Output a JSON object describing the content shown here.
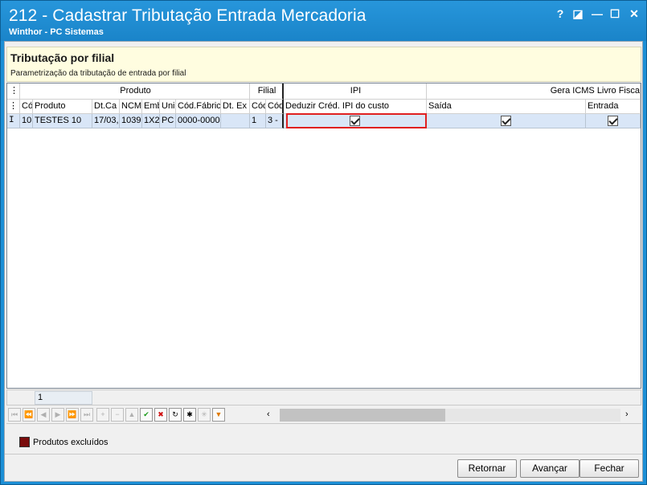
{
  "window": {
    "title": "212 - Cadastrar Tributação Entrada Mercadoria",
    "subtitle": "Winthor - PC Sistemas",
    "help_glyph": "?",
    "restore_glyph": "◪",
    "minimize_glyph": "—",
    "maximize_glyph": "☐",
    "close_glyph": "✕"
  },
  "header": {
    "title": "Tributação por filial",
    "description": "Parametrização da tributação de entrada por filial"
  },
  "grid": {
    "bands": {
      "produto": "Produto",
      "filial": "Filial",
      "ipi": "IPI",
      "gera_icms": "Gera ICMS Livro Fisca"
    },
    "columns": {
      "cod": "Cód",
      "produto": "Produto",
      "dtcad": "Dt.Ca",
      "ncm": "NCM",
      "emb": "Emb",
      "unid": "Uni",
      "codfab": "Cód.Fábric",
      "dtexc": "Dt. Ex",
      "codfil": "Cód",
      "codfil2": "Cód",
      "deduzir": "Deduzir Créd. IPI do custo",
      "saida": "Saída",
      "entrada": "Entrada"
    },
    "rows": [
      {
        "indicator": "I",
        "cod": "10",
        "produto": "TESTES 10",
        "dtcad": "17/03,",
        "ncm": "1039",
        "emb": "1X2",
        "unid": "PC",
        "codfab": "0000-0000",
        "dtexc": "",
        "codfil": "1",
        "codfil2": "3 -",
        "deduzir_checked": true,
        "saida_checked": true,
        "entrada_checked": true
      }
    ]
  },
  "footer": {
    "count": "1"
  },
  "legend": {
    "label": "Produtos excluídos",
    "color": "#7a0c0c"
  },
  "buttons": {
    "retornar": "Retornar",
    "avancar": "Avançar",
    "fechar": "Fechar"
  },
  "colors": {
    "titlebar": "#1c8fd6",
    "header_bg": "#fffde0",
    "selected_row": "#d9e6f7",
    "highlight": "#e02020"
  }
}
